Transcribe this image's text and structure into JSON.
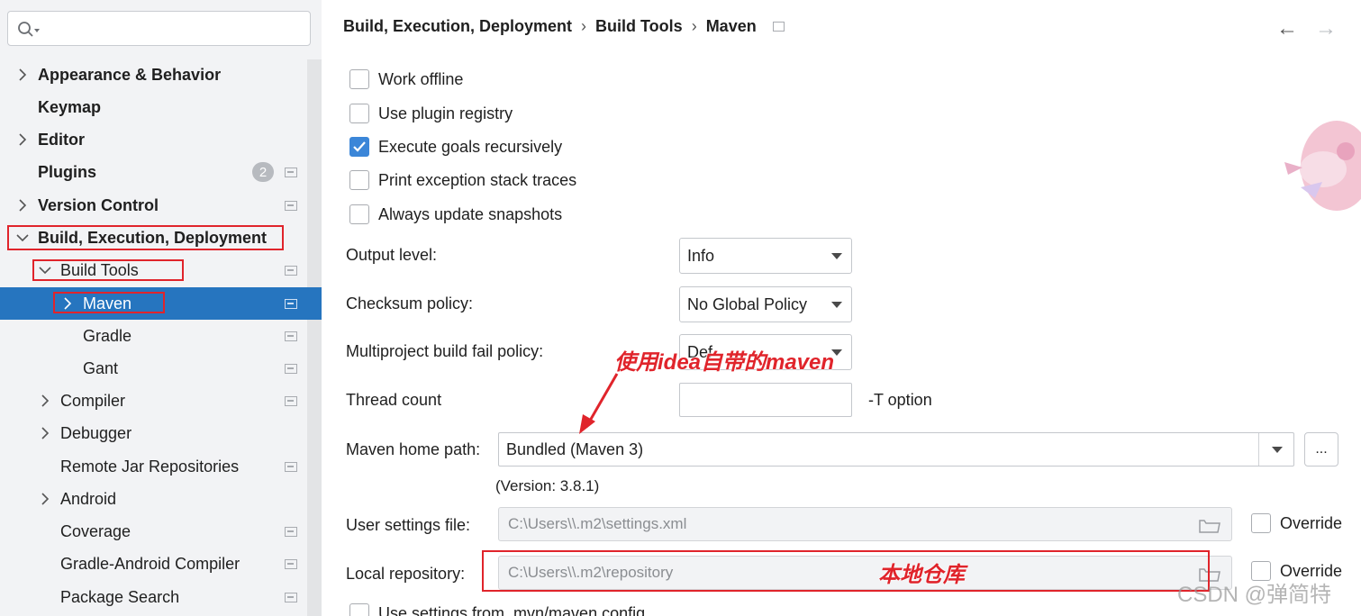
{
  "sidebar": {
    "search": {
      "placeholder": ""
    },
    "items": [
      {
        "label": "Appearance & Behavior"
      },
      {
        "label": "Keymap"
      },
      {
        "label": "Editor"
      },
      {
        "label": "Plugins",
        "badge": "2"
      },
      {
        "label": "Version Control"
      },
      {
        "label": "Build, Execution, Deployment"
      },
      {
        "label": "Build Tools"
      },
      {
        "label": "Maven"
      },
      {
        "label": "Gradle"
      },
      {
        "label": "Gant"
      },
      {
        "label": "Compiler"
      },
      {
        "label": "Debugger"
      },
      {
        "label": "Remote Jar Repositories"
      },
      {
        "label": "Android"
      },
      {
        "label": "Coverage"
      },
      {
        "label": "Gradle-Android Compiler"
      },
      {
        "label": "Package Search"
      }
    ]
  },
  "breadcrumb": [
    "Build, Execution, Deployment",
    "Build Tools",
    "Maven"
  ],
  "nav": {
    "back": "←",
    "forward": "→"
  },
  "checkboxes": [
    {
      "label": "Work offline",
      "checked": false
    },
    {
      "label": "Use plugin registry",
      "checked": false
    },
    {
      "label": "Execute goals recursively",
      "checked": true
    },
    {
      "label": "Print exception stack traces",
      "checked": false
    },
    {
      "label": "Always update snapshots",
      "checked": false
    }
  ],
  "form": {
    "output_level": {
      "label": "Output level:",
      "value": "Info"
    },
    "checksum_policy": {
      "label": "Checksum policy:",
      "value": "No Global Policy"
    },
    "fail_policy": {
      "label": "Multiproject build fail policy:",
      "value": "Def"
    },
    "thread_count": {
      "label": "Thread count",
      "value": "",
      "suffix": "-T option"
    },
    "maven_home": {
      "label": "Maven home path:",
      "value": "Bundled (Maven 3)",
      "browse": "...",
      "version": "(Version: 3.8.1)"
    },
    "user_settings": {
      "label": "User settings file:",
      "value": "C:\\Users\\\\.m2\\settings.xml",
      "override": "Override"
    },
    "local_repo": {
      "label": "Local repository:",
      "value": "C:\\Users\\\\.m2\\repository",
      "override": "Override"
    },
    "bottom_checkbox": {
      "label": "Use settings from .mvn/maven.config"
    }
  },
  "annotations": {
    "bundled_maven": "使用idea自带的maven",
    "local_repo": "本地仓库"
  },
  "watermark": "CSDN @弹简特",
  "colors": {
    "selection": "#2675bf",
    "accent": "#3b86d8",
    "annotation": "#e0242b"
  }
}
